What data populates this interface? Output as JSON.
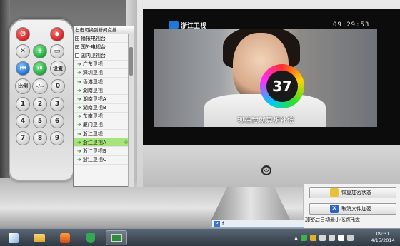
{
  "remote": {
    "buttons": {
      "power": "",
      "stop": "",
      "mute": "",
      "plus": "",
      "pip": "",
      "prev": "",
      "playpause": "",
      "settings": "设置",
      "aspect": "比例",
      "minus": "-/--",
      "n0": "0",
      "n1": "1",
      "n2": "2",
      "n3": "3",
      "n4": "4",
      "n5": "5",
      "n6": "6",
      "n7": "7",
      "n8": "8",
      "n9": "9"
    }
  },
  "channel_panel": {
    "header": "右击切换到新闻点播",
    "items": [
      {
        "label": "播报电视台",
        "type": "group",
        "box": "+"
      },
      {
        "label": "国外电视台",
        "type": "group",
        "box": "+"
      },
      {
        "label": "国内卫视台",
        "type": "group",
        "box": "-"
      },
      {
        "label": "广东卫视",
        "type": "channel"
      },
      {
        "label": "深圳卫视",
        "type": "channel"
      },
      {
        "label": "香港卫视",
        "type": "channel"
      },
      {
        "label": "湖南卫视",
        "type": "channel"
      },
      {
        "label": "湖南卫视A",
        "type": "channel"
      },
      {
        "label": "湖南卫视B",
        "type": "channel"
      },
      {
        "label": "东南卫视",
        "type": "channel"
      },
      {
        "label": "厦门卫视",
        "type": "channel"
      },
      {
        "label": "浙江卫视",
        "type": "channel"
      },
      {
        "label": "浙江卫视A",
        "type": "channel",
        "selected": true
      },
      {
        "label": "浙江卫视B",
        "type": "channel"
      },
      {
        "label": "浙江卫视C",
        "type": "channel"
      }
    ]
  },
  "player": {
    "logo_text": "浙江卫视",
    "clock": "09:29:53",
    "countdown": "37",
    "subtitle": "现在我就算想补偿"
  },
  "side_panel": {
    "restore_label": "恢复加密状态",
    "cancel_label": "取消文件加密",
    "caption": "加密后自动最小化到托盘"
  },
  "note": {
    "icon": "P",
    "text": "f"
  },
  "taskbar": {
    "time": "09:31",
    "date": "4/15/2014"
  },
  "colors": {
    "selected_row": "#a8e27a",
    "taskbar": "#2f3943"
  }
}
